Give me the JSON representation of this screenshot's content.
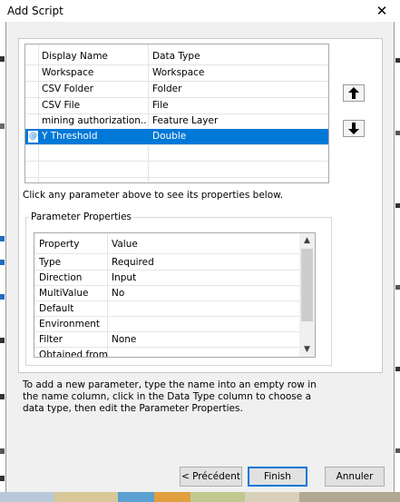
{
  "window": {
    "title": "Add Script",
    "close_glyph": "✕"
  },
  "grid": {
    "headers": {
      "display_name": "Display Name",
      "data_type": "Data Type"
    },
    "rows": [
      {
        "display_name": "Workspace",
        "data_type": "Workspace"
      },
      {
        "display_name": "CSV Folder",
        "data_type": "Folder"
      },
      {
        "display_name": "CSV File",
        "data_type": "File"
      },
      {
        "display_name": "mining authorization...",
        "data_type": "Feature Layer"
      },
      {
        "display_name": "Y Threshold",
        "data_type": "Double",
        "selected": true
      }
    ],
    "selected_row_glyph": "@"
  },
  "reorder": {
    "up_icon": "arrow-up-icon",
    "down_icon": "arrow-down-icon"
  },
  "hint": "Click any parameter above to see its properties below.",
  "parameter_properties": {
    "group_label": "Parameter Properties",
    "headers": {
      "property": "Property",
      "value": "Value"
    },
    "rows": [
      {
        "property": "Type",
        "value": "Required"
      },
      {
        "property": "Direction",
        "value": "Input"
      },
      {
        "property": "MultiValue",
        "value": "No"
      },
      {
        "property": "Default",
        "value": ""
      },
      {
        "property": "Environment",
        "value": ""
      },
      {
        "property": "Filter",
        "value": "None"
      },
      {
        "property": "Obtained from",
        "value": ""
      }
    ],
    "scroll_up_glyph": "▲",
    "scroll_down_glyph": "▼"
  },
  "help_text": "To add a new parameter, type the name into an empty row in the name column, click in the Data Type column to choose a data type, then edit the Parameter Properties.",
  "buttons": {
    "previous": "< Précédent",
    "finish": "Finish",
    "cancel": "Annuler"
  },
  "colors": {
    "selection": "#0078d7",
    "default_button_border": "#0078d7",
    "dialog_bg": "#f0f0f0"
  }
}
